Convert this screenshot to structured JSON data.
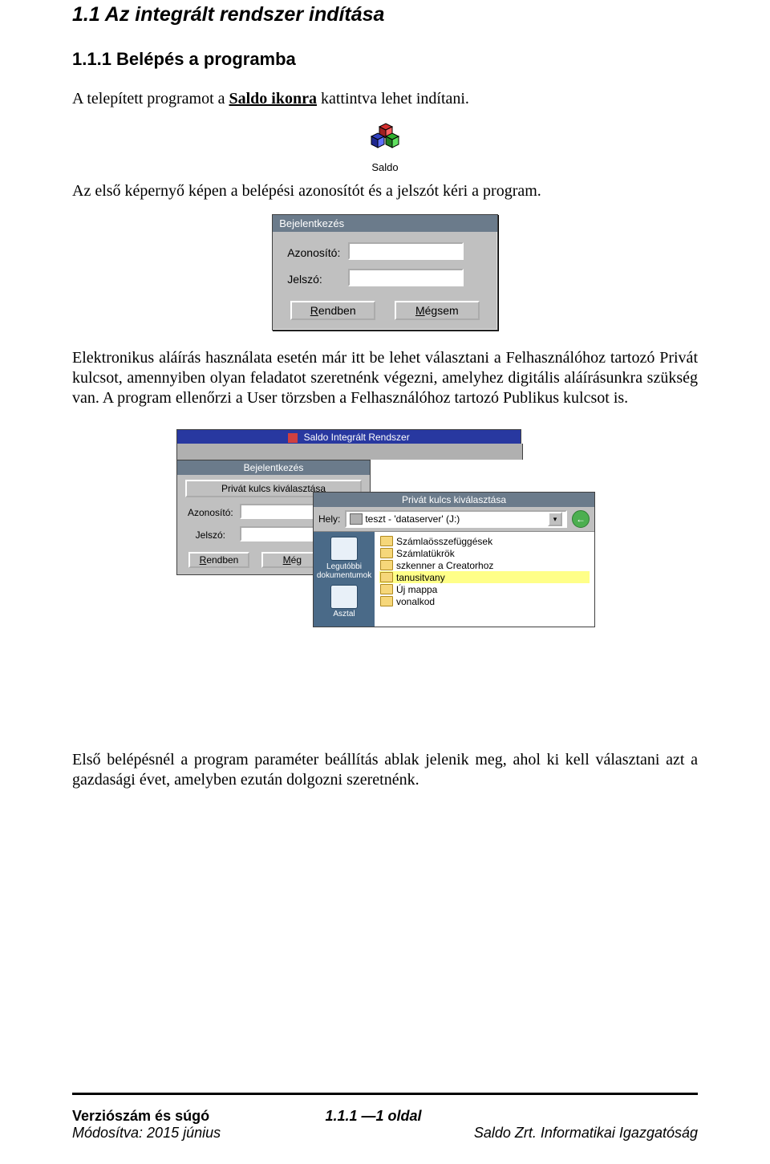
{
  "headings": {
    "h2": "1.1  Az integrált rendszer indítása",
    "h3": "1.1.1 Belépés a programba"
  },
  "paragraphs": {
    "p1_pre": "A telepített programot a ",
    "p1_bold": "Saldo ikonra",
    "p1_post": " kattintva lehet indítani.",
    "p2": "Az első képernyő képen a belépési azonosítót és a jelszót kéri a program.",
    "p3": "Elektronikus aláírás használata esetén már itt be lehet választani a Felhasználóhoz tartozó Privát kulcsot, amennyiben olyan feladatot szeretnénk végezni, amelyhez digitális aláírásunkra szükség van. A program ellenőrzi a User törzsben a Felhasználóhoz tartozó Publikus kulcsot is.",
    "p4": "Első belépésnél a program paraméter beállítás ablak jelenik meg, ahol ki kell választani azt a gazdasági évet, amelyben ezután dolgozni szeretnénk."
  },
  "saldo_icon_label": "Saldo",
  "login_dialog": {
    "title": "Bejelentkezés",
    "id_label": "Azonosító:",
    "pw_label": "Jelszó:",
    "ok_label": "Rendben",
    "ok_ul": "R",
    "cancel_label": "Mégsem",
    "cancel_ul": "M"
  },
  "screenshot2": {
    "main_title": "Saldo Integrált Rendszer",
    "login": {
      "title": "Bejelentkezés",
      "priv_btn": "Privát kulcs kiválasztása",
      "id_label": "Azonosító:",
      "pw_label": "Jelszó:",
      "ok": "Rendben",
      "cancel": "Még"
    },
    "filedlg": {
      "title": "Privát kulcs kiválasztása",
      "hely_label": "Hely:",
      "combo_value": "teszt - 'dataserver' (J:)",
      "side": {
        "recent": "Legutóbbi dokumentumok",
        "desktop": "Asztal"
      },
      "items": [
        {
          "name": "Számlaösszefüggések",
          "selected": false
        },
        {
          "name": "Számlatükrök",
          "selected": false
        },
        {
          "name": "szkenner a Creatorhoz",
          "selected": false
        },
        {
          "name": "tanusitvany",
          "selected": true
        },
        {
          "name": "Új mappa",
          "selected": false
        },
        {
          "name": "vonalkod",
          "selected": false
        }
      ]
    }
  },
  "footer": {
    "left1": "Verziószám és súgó",
    "center1": "1.1.1 —1 oldal",
    "left2": "Módosítva: 2015 június",
    "right2": "Saldo Zrt. Informatikai Igazgatóság"
  }
}
